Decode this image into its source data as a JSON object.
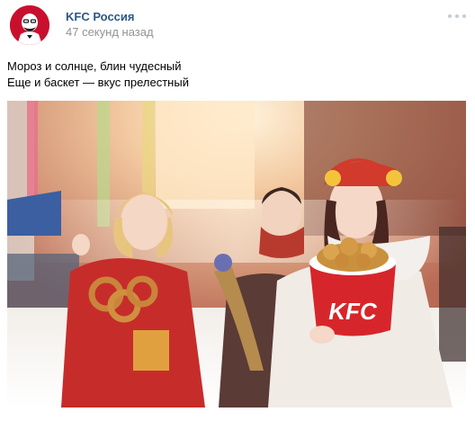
{
  "post": {
    "author": "KFC Россия",
    "time": "47 секунд назад",
    "text_lines": [
      "Мороз и солнце, блин чудесный",
      "Еще и баскет — вкус прелестный"
    ],
    "bucket_logo": "KFC"
  },
  "icons": {
    "avatar": "colonel-sanders-logo",
    "more": "more-dots-icon"
  },
  "colors": {
    "author_link": "#2a5885",
    "timestamp": "#939393",
    "kfc_red": "#c8102e"
  }
}
